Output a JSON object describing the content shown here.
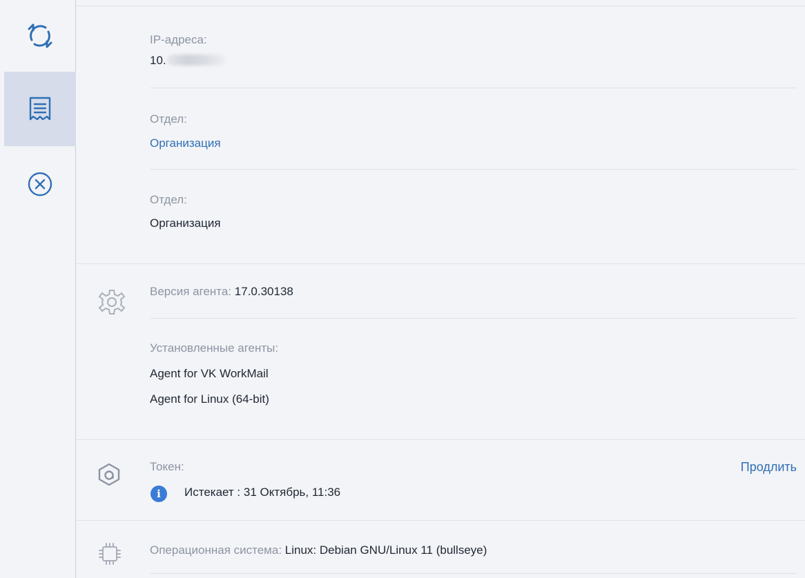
{
  "sidebar": {
    "items": [
      {
        "name": "refresh-icon",
        "active": false
      },
      {
        "name": "details-icon",
        "active": true
      },
      {
        "name": "close-circle-icon",
        "active": false
      }
    ]
  },
  "details": {
    "ip": {
      "label": "IP-адреса:",
      "value_prefix": "10."
    },
    "department_link": {
      "label": "Отдел:",
      "value": "Организация"
    },
    "department": {
      "label": "Отдел:",
      "value": "Организация"
    },
    "agent_version": {
      "label": "Версия агента: ",
      "value": "17.0.30138"
    },
    "installed_agents": {
      "label": "Установленные агенты:",
      "items": [
        "Agent for VK WorkMail",
        "Agent for Linux (64-bit)"
      ]
    },
    "token": {
      "label": "Токен:",
      "expires": "Истекает : 31 Октябрь, 11:36",
      "renew_label": "Продлить",
      "info_glyph": "i"
    },
    "os": {
      "label": "Операционная система: ",
      "value": "Linux: Debian GNU/Linux 11 (bullseye)"
    }
  },
  "colors": {
    "accent": "#3a7bd5",
    "link": "#2f6fb5",
    "active_bg": "#d6dcea"
  }
}
